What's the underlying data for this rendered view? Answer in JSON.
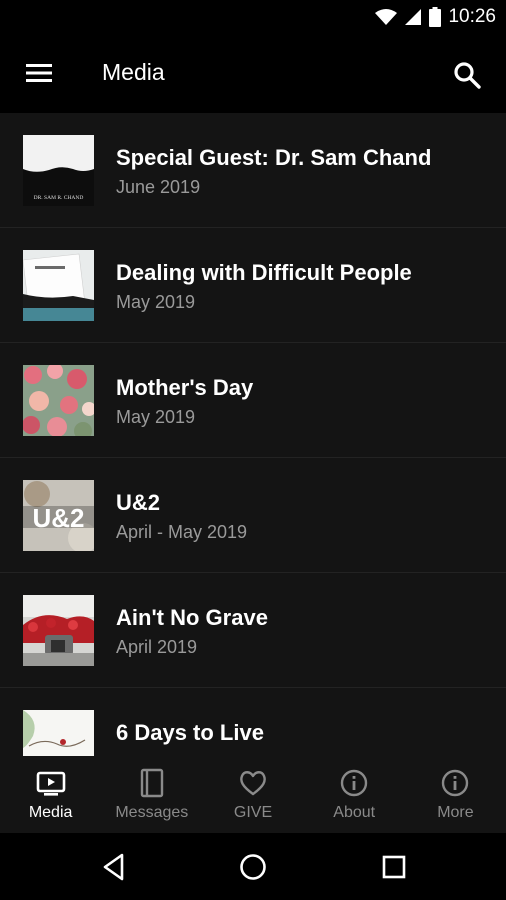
{
  "status_bar": {
    "time": "10:26"
  },
  "app_bar": {
    "title": "Media"
  },
  "media_items": [
    {
      "title": "Special Guest: Dr. Sam Chand",
      "subtitle": "June 2019",
      "thumb_text": "DR. SAM R. CHAND"
    },
    {
      "title": "Dealing with Difficult People",
      "subtitle": "May 2019"
    },
    {
      "title": "Mother's Day",
      "subtitle": "May 2019"
    },
    {
      "title": "U&2",
      "subtitle": "April - May 2019",
      "thumb_text": "U&2"
    },
    {
      "title": "Ain't No Grave",
      "subtitle": "April 2019"
    },
    {
      "title": "6 Days to Live",
      "subtitle": ""
    }
  ],
  "bottom_nav": [
    {
      "label": "Media",
      "icon": "tv-icon",
      "active": true
    },
    {
      "label": "Messages",
      "icon": "book-icon",
      "active": false
    },
    {
      "label": "GIVE",
      "icon": "heart-icon",
      "active": false
    },
    {
      "label": "About",
      "icon": "info-icon",
      "active": false
    },
    {
      "label": "More",
      "icon": "info-icon",
      "active": false
    }
  ],
  "colors": {
    "background": "#141414",
    "bars": "#000000",
    "subtitle": "#9a9a9a",
    "nav_inactive": "#8a8a8a"
  }
}
